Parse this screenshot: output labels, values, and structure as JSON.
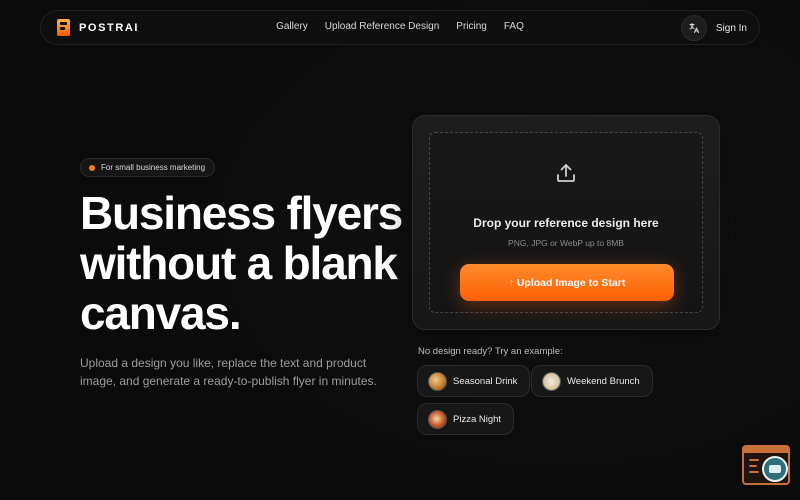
{
  "nav": {
    "brand": "POSTRAI",
    "links": [
      "Gallery",
      "Upload Reference Design",
      "Pricing",
      "FAQ"
    ],
    "language_icon": "translate-icon",
    "signin_label": "Sign In"
  },
  "hero": {
    "badge": "For small business marketing",
    "title_lines": [
      "Business flyers",
      "without a blank",
      "canvas."
    ],
    "subtitle": "Upload a design you like, replace the text and product image, and generate a ready-to-publish flyer in minutes."
  },
  "upload": {
    "icon": "upload-icon",
    "title": "Drop your reference design here",
    "hint": "PNG, JPG or WebP up to 8MB",
    "button_label": "↑ Upload Image to Start"
  },
  "examples": {
    "label": "No design ready? Try an example:",
    "items": [
      {
        "label": "Seasonal Drink",
        "thumb": "drink-thumbnail"
      },
      {
        "label": "Weekend Brunch",
        "thumb": "brunch-thumbnail"
      },
      {
        "label": "Pizza Night",
        "thumb": "pizza-thumbnail"
      }
    ]
  },
  "colors": {
    "accent": "#ff6a0f",
    "background": "#0b0b0b"
  },
  "floating_widget": {
    "icon": "inspect-widget-icon"
  }
}
